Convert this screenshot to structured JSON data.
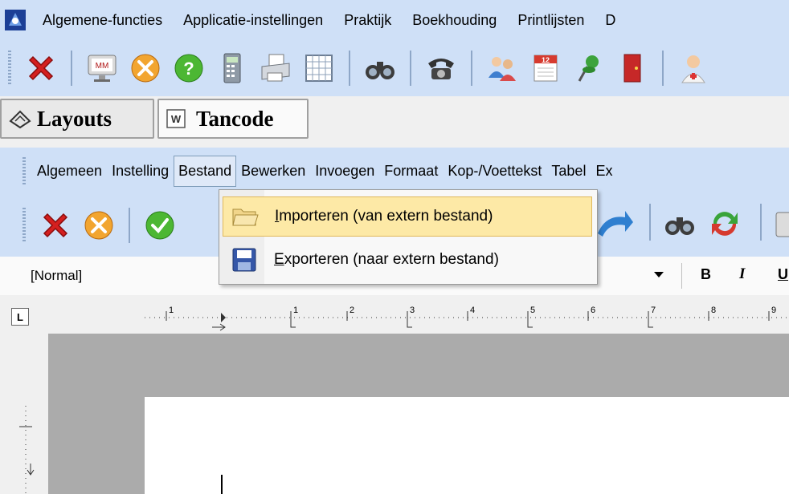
{
  "menubar": {
    "items": [
      "Algemene-functies",
      "Applicatie-instellingen",
      "Praktijk",
      "Boekhouding",
      "Printlijsten",
      "D"
    ]
  },
  "main_toolbar": {
    "icons": [
      "close-icon",
      "monitor-mm-icon",
      "tools-icon",
      "help-icon",
      "calculator-icon",
      "printer-icon",
      "grid-icon",
      "binoculars-icon",
      "telephone-icon",
      "users-icon",
      "calendar-icon",
      "pin-icon",
      "exit-door-icon",
      "doctor-icon"
    ],
    "calendar_day": "12",
    "monitor_text": "MM"
  },
  "tabs": [
    {
      "label": "Layouts",
      "icon": "layouts-icon"
    },
    {
      "label": "Tancode",
      "icon": "word-doc-icon",
      "icon_text": "W"
    }
  ],
  "editor_menu": {
    "items": [
      "Algemeen",
      "Instelling",
      "Bestand",
      "Bewerken",
      "Invoegen",
      "Formaat",
      "Kop-/Voettekst",
      "Tabel",
      "Ex"
    ],
    "open_item": "Bestand"
  },
  "dropdown": {
    "items": [
      {
        "label": "Importeren (van extern bestand)",
        "icon": "folder-open-icon",
        "highlighted": true,
        "accelerator": "I"
      },
      {
        "label": "Exporteren (naar extern bestand)",
        "icon": "save-disk-icon",
        "highlighted": false,
        "accelerator": "E"
      }
    ]
  },
  "format_bar": {
    "style_value": "[Normal]",
    "bold_label": "B",
    "italic_label": "I",
    "underline_label": "U"
  },
  "ruler": {
    "corner_label": "L",
    "numbers": [
      "1",
      "1",
      "2",
      "3",
      "4",
      "5",
      "6",
      "7",
      "8",
      "9"
    ]
  },
  "colors": {
    "toolbar_bg": "#cfe0f7",
    "highlight": "#fde9a6",
    "document_bg": "#ababab"
  }
}
